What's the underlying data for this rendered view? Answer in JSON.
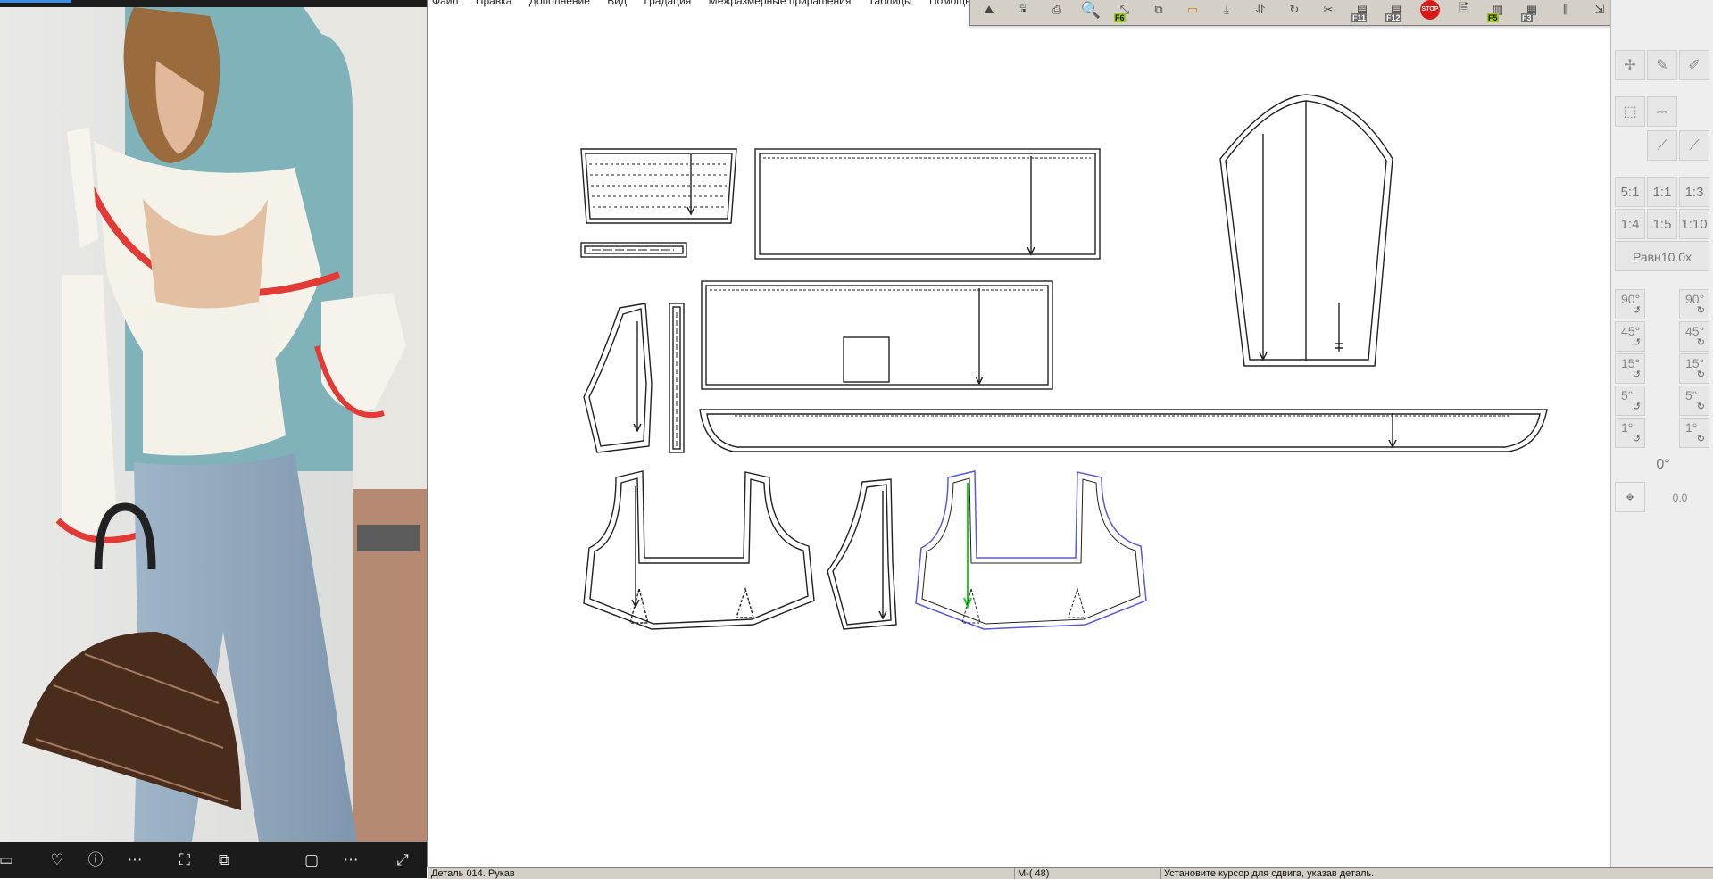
{
  "viewer": {
    "toolbar_icons": [
      "screen-icon",
      "heart-icon",
      "info-icon",
      "more-icon",
      "crop-icon",
      "ocr-icon",
      "fit-icon",
      "more-icon",
      "fullscreen-icon"
    ]
  },
  "app": {
    "menu": [
      "Файл",
      "Правка",
      "Дополнение",
      "Вид",
      "Градация",
      "Межразмерные приращения",
      "Таблицы",
      "Помощь"
    ],
    "toolbar": {
      "f6_label": "F6",
      "f11_label": "F11",
      "f12_label": "F12",
      "stop_label": "STOP",
      "f5_label": "F5",
      "f3_label": "F3"
    },
    "right_panel": {
      "scales": [
        "5:1",
        "1:1",
        "1:3",
        "1:4",
        "1:5",
        "1:10"
      ],
      "equal_label": "Равн10.0x",
      "angles": [
        "90°",
        "45°",
        "15°",
        "5°",
        "1°"
      ],
      "zero_angle": "0°",
      "value": "0.0"
    },
    "status": {
      "piece": "Деталь 014. Рукав",
      "size": "M-( 48)",
      "hint": "Установите курсор для сдвига, указав деталь."
    },
    "colors": {
      "selected_outline": "#5a5adc",
      "grainline_selected": "#22cc22",
      "pattern_line": "#222222"
    }
  }
}
